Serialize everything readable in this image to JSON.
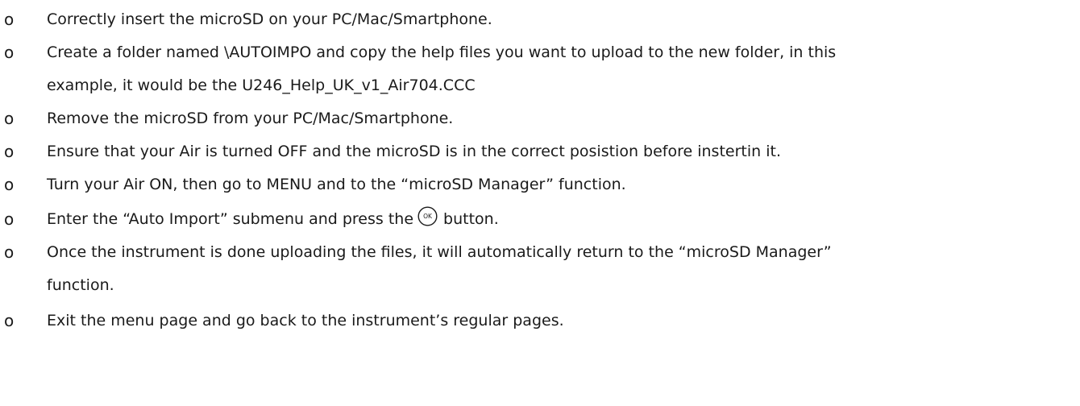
{
  "bullet_glyph": "o",
  "steps": [
    {
      "text": "Correctly insert the microSD on your  PC/Mac/Smartphone."
    },
    {
      "line1": "Create a folder named \\AUTOIMPO and copy the help files you want to upload to the new folder, in this",
      "line2": "example, it would be the U246_Help_UK_v1_Air704.CCC"
    },
    {
      "text": "Remove the microSD from your  PC/Mac/Smartphone."
    },
    {
      "text": "Ensure that your Air is turned OFF and the microSD is in the correct posistion before instertin it."
    },
    {
      "text": "Turn your Air ON, then go to MENU and to the “microSD Manager” function."
    },
    {
      "before_icon": "Enter the “Auto Import” submenu and press the",
      "icon": "ok-button-icon",
      "icon_label": "OK",
      "after_icon": "button."
    },
    {
      "line1": "Once the instrument is done uploading the files, it will automatically return to the “microSD Manager”",
      "line2": "function."
    },
    {
      "text": "Exit the menu page and go back to the instrument’s regular pages."
    }
  ]
}
